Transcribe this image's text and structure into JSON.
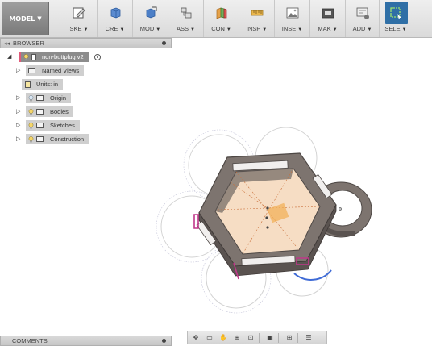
{
  "toolbar": {
    "workspace": {
      "label": "MODEL",
      "icon": "caret-down-icon"
    },
    "groups": [
      {
        "label": "SKE",
        "icon": "sketch-icon",
        "color": "#5a5a5a"
      },
      {
        "label": "CRE",
        "icon": "create-box-icon",
        "color": "#3f6fb0"
      },
      {
        "label": "MOD",
        "icon": "modify-icon",
        "color": "#3f6fb0"
      },
      {
        "label": "ASS",
        "icon": "assemble-icon",
        "color": "#5a5a5a"
      },
      {
        "label": "CON",
        "icon": "construct-plane-icon",
        "color": "#d58c2c"
      },
      {
        "label": "INSP",
        "icon": "inspect-measure-icon",
        "color": "#d58c2c"
      },
      {
        "label": "INSE",
        "icon": "insert-image-icon",
        "color": "#5a5a5a"
      },
      {
        "label": "MAK",
        "icon": "make-print-icon",
        "color": "#5a5a5a"
      },
      {
        "label": "ADD",
        "icon": "add-ins-icon",
        "color": "#5a5a5a"
      },
      {
        "label": "SELE",
        "icon": "select-icon",
        "color": "#2f6fa6",
        "active": true
      }
    ]
  },
  "browser": {
    "title": "BROWSER",
    "root": {
      "label": "non-buttplug v2"
    },
    "items": [
      {
        "label": "Named Views",
        "expandable": true,
        "has_bulb": false
      },
      {
        "label": "Units: in",
        "expandable": false,
        "has_bulb": false
      },
      {
        "label": "Origin",
        "expandable": true,
        "has_bulb": true
      },
      {
        "label": "Bodies",
        "expandable": true,
        "has_bulb": true
      },
      {
        "label": "Sketches",
        "expandable": true,
        "has_bulb": true
      },
      {
        "label": "Construction",
        "expandable": true,
        "has_bulb": true
      }
    ]
  },
  "comments": {
    "title": "COMMENTS"
  },
  "colors": {
    "body": "#7d746f",
    "body_dark": "#5a5350",
    "sketch_fill": "#f6ddc4",
    "selection": "#c0378a",
    "circle_hover": "#3f6bd6"
  },
  "nav_icons": [
    "orbit-icon",
    "pan-icon",
    "look-at-icon",
    "zoom-icon",
    "fit-icon",
    "display-settings-icon",
    "grid-icon",
    "viewports-icon"
  ]
}
